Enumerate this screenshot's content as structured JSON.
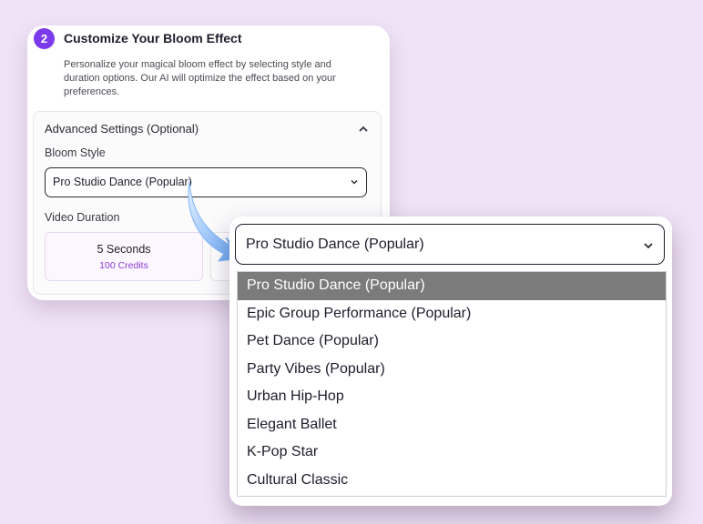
{
  "step": {
    "number": "2",
    "title": "Customize Your Bloom Effect",
    "description": "Personalize your magical bloom effect by selecting style and duration options. Our AI will optimize the effect based on your preferences."
  },
  "advanced": {
    "title": "Advanced Settings (Optional)",
    "bloom_style_label": "Bloom Style",
    "bloom_style_value": "Pro Studio Dance (Popular)",
    "video_duration_label": "Video Duration",
    "durations": [
      {
        "title": "5 Seconds",
        "credits": "100 Credits"
      }
    ]
  },
  "dropdown": {
    "selected": "Pro Studio Dance (Popular)",
    "options": [
      "Pro Studio Dance (Popular)",
      "Epic Group Performance (Popular)",
      "Pet Dance (Popular)",
      "Party Vibes (Popular)",
      "Urban Hip-Hop",
      "Elegant Ballet",
      "K-Pop Star",
      "Cultural Classic"
    ],
    "highlighted_index": 0
  },
  "colors": {
    "accent": "#7c3aed",
    "background": "#f1e3f7",
    "highlight": "#7b7b7b"
  }
}
